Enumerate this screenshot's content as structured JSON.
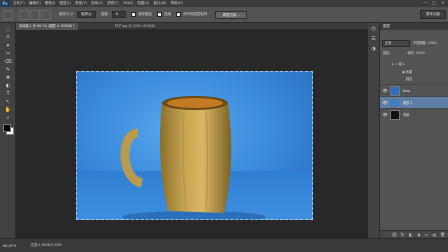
{
  "menu": {
    "logo": "Ps",
    "items": [
      "文件(F)",
      "编辑(E)",
      "图像(I)",
      "图层(L)",
      "类型(Y)",
      "选择(S)",
      "滤镜(T)",
      "3D(D)",
      "视图(V)",
      "窗口(W)",
      "帮助(H)"
    ],
    "controls": [
      "—",
      "□",
      "✕"
    ]
  },
  "options": {
    "size_label": "取样大小:",
    "size_value": "取样点",
    "tolerance_label": "容差:",
    "tolerance_value": "8",
    "antialias_label": "消除锯齿",
    "contiguous_label": "连续",
    "all_layers_label": "对所有图层取样",
    "refine_button": "调整边缘...",
    "workspace": "基本功能"
  },
  "tabs": [
    {
      "label": "未标题-1 @ 66.7% (图层 0, RGB/8) *",
      "active": true
    },
    {
      "label": "杯子.jpg @ 100% (RGB/8)",
      "active": false
    }
  ],
  "tools": [
    "⬚",
    "⤧",
    "✦",
    "✂",
    "⌫",
    "✎",
    "✚",
    "◐",
    "T",
    "↖",
    "✋",
    "⌕"
  ],
  "colors": {
    "foreground": "#000000",
    "background": "#ffffff",
    "accent": "#5f7ea6"
  },
  "status": {
    "zoom": "66.67%",
    "doc": "文档:1.65M/5.50M"
  },
  "layers_panel": {
    "title": "图层",
    "blend_mode": "正常",
    "opacity_label": "不透明度: 100%",
    "fill_label": "填充: 100%",
    "lock_label": "锁定:",
    "group_label": "组 1",
    "effects_label": "效果",
    "stroke_label": "描边",
    "layers": [
      {
        "name": "bmp",
        "selected": false,
        "thumb": "#2f6fbf"
      },
      {
        "name": "图层 1",
        "selected": true,
        "thumb": "#3a7fcf"
      },
      {
        "name": "背景",
        "selected": false,
        "thumb": "#111111"
      }
    ],
    "footer_icons": [
      "⛓",
      "fx",
      "◧",
      "◑",
      "▭",
      "▤",
      "🗑"
    ]
  }
}
